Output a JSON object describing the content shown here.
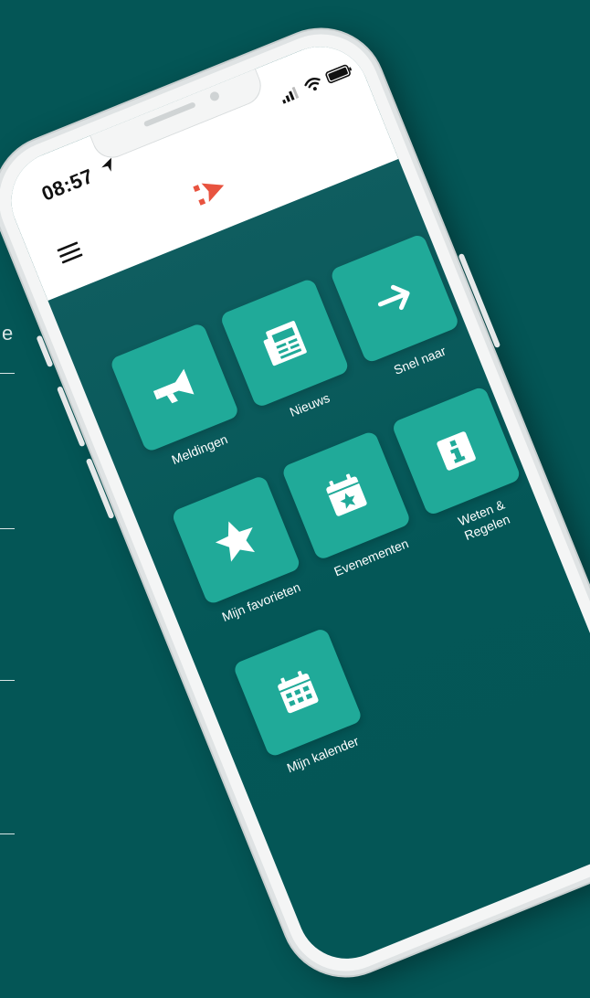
{
  "status_bar": {
    "time": "08:57"
  },
  "tiles": [
    {
      "label": "Meldingen",
      "icon": "megaphone-icon"
    },
    {
      "label": "Nieuws",
      "icon": "newspaper-icon"
    },
    {
      "label": "Snel naar",
      "icon": "arrow-right-icon"
    },
    {
      "label": "Mijn favorieten",
      "icon": "star-icon"
    },
    {
      "label": "Evenementen",
      "icon": "calendar-star-icon"
    },
    {
      "label": "Weten &\nRegelen",
      "icon": "info-icon"
    },
    {
      "label": "Mijn kalender",
      "icon": "calendar-icon"
    }
  ],
  "colors": {
    "background": "#045656",
    "tile": "#20aa99",
    "logo": "#e8533f",
    "app_bar": "#ffffff"
  }
}
